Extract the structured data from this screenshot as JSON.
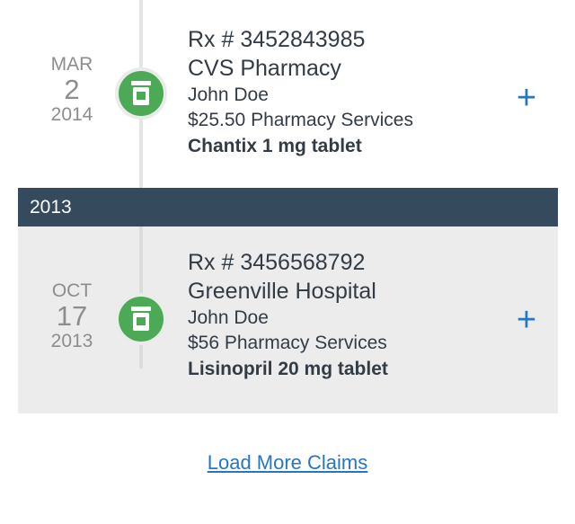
{
  "claims": [
    {
      "date": {
        "month": "MAR",
        "day": "2",
        "year": "2014"
      },
      "rx": "Rx # 3452843985",
      "pharmacy": "CVS Pharmacy",
      "member": "John Doe",
      "amount": "$25.50 Pharmacy Services",
      "drug": "Chantix 1 mg tablet",
      "expand_label": "+",
      "icon": "pill-bottle-icon"
    },
    {
      "date": {
        "month": "OCT",
        "day": "17",
        "year": "2013"
      },
      "rx": "Rx # 3456568792",
      "pharmacy": "Greenville Hospital",
      "member": "John Doe",
      "amount": "$56 Pharmacy Services",
      "drug": "Lisinopril 20 mg tablet",
      "expand_label": "+",
      "icon": "pill-bottle-icon"
    }
  ],
  "year_header": "2013",
  "load_more_label": "Load More Claims",
  "colors": {
    "accent": "#2776c2",
    "icon_green": "#4caa57",
    "year_header_bg": "#354a5d",
    "claim_highlight_bg": "#ececec",
    "date_gray": "#8d8d8d"
  }
}
